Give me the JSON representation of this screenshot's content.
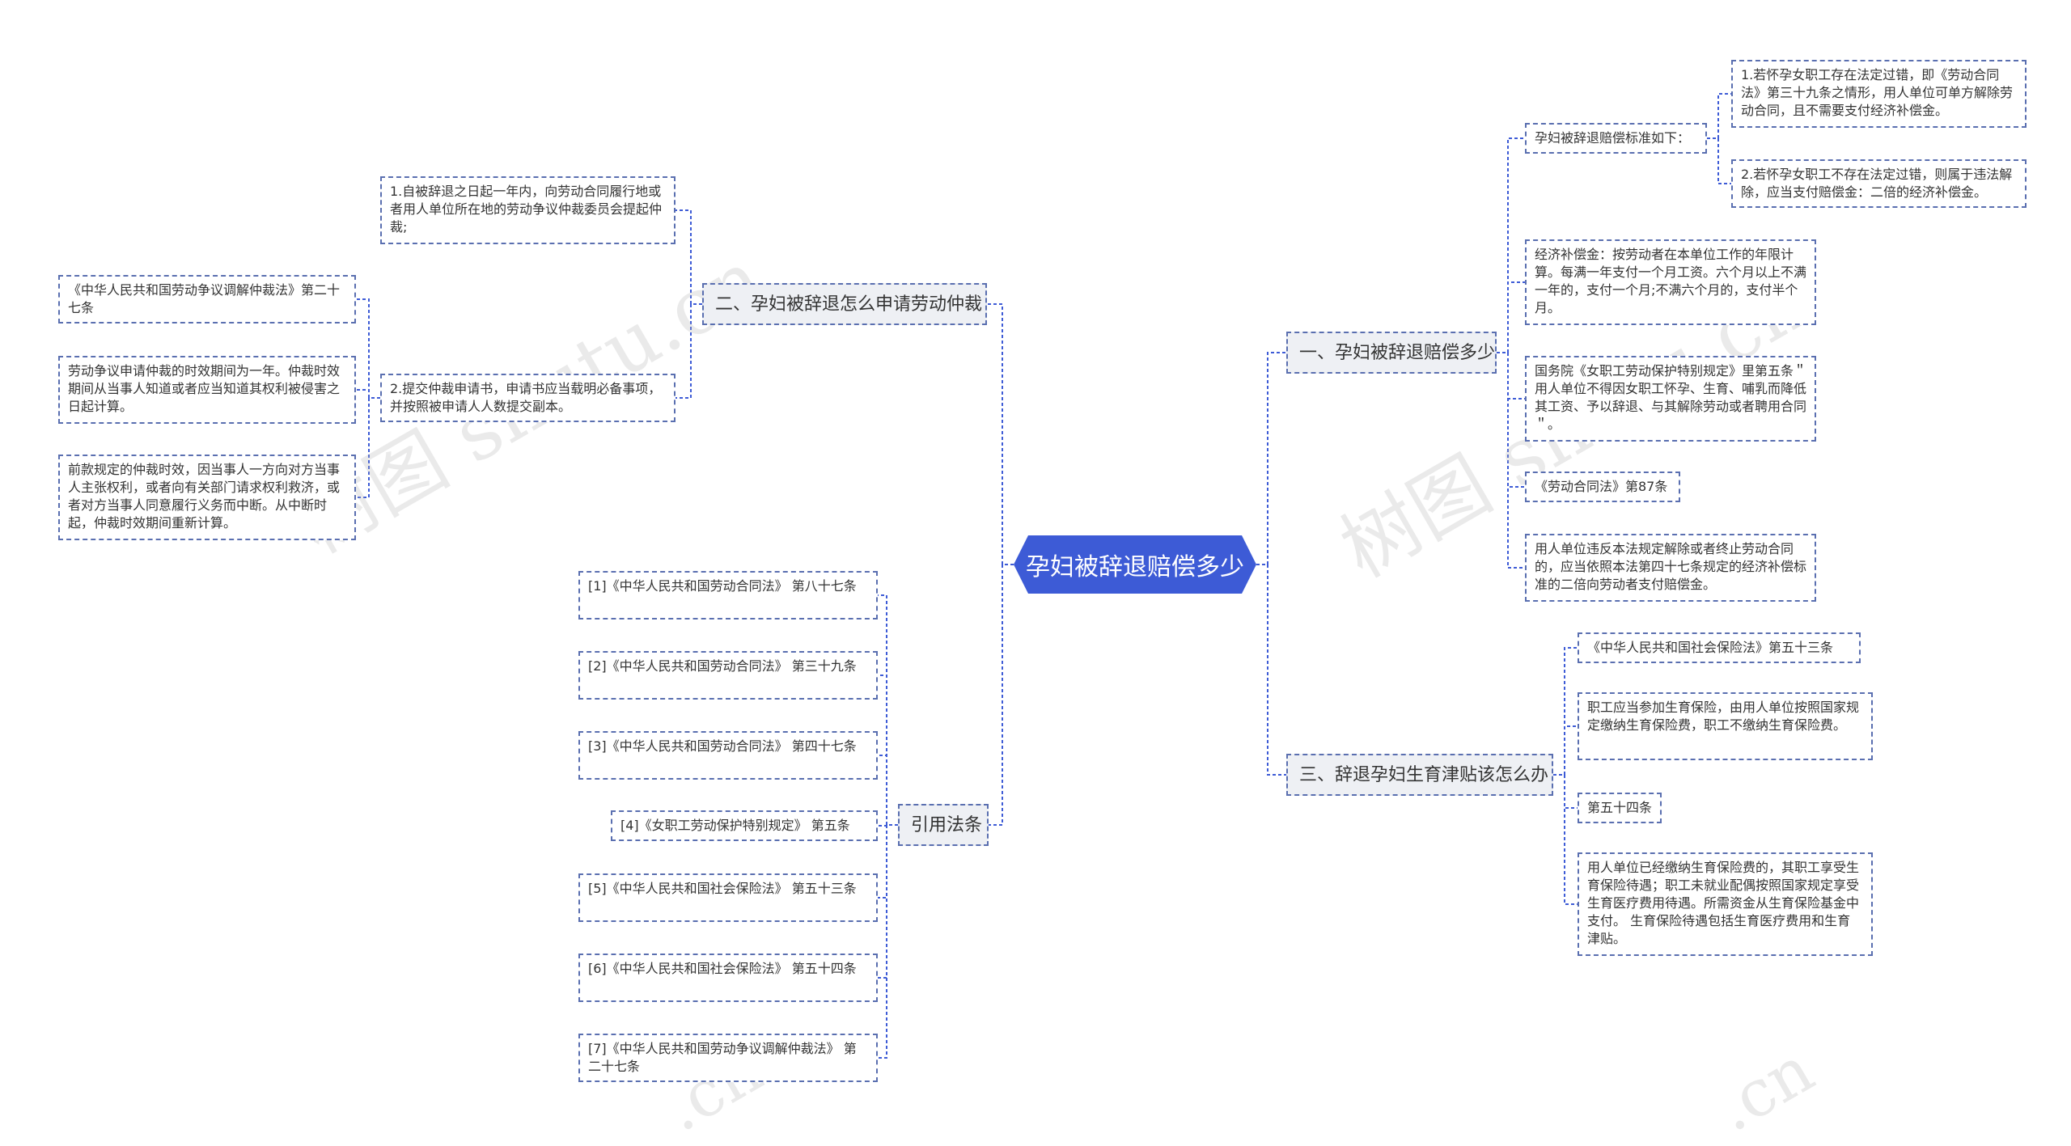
{
  "root": {
    "label": "孕妇被辞退赔偿多少"
  },
  "branches": {
    "b1": {
      "label": "一、孕妇被辞退赔偿多少"
    },
    "b2": {
      "label": "二、孕妇被辞退怎么申请劳动仲裁"
    },
    "b3": {
      "label": "三、辞退孕妇生育津贴该怎么办"
    },
    "b4": {
      "label": "引用法条"
    }
  },
  "b1_children": {
    "standard": "孕妇被辞退赔偿标准如下：",
    "standard_1": "1.若怀孕女职工存在法定过错，即《劳动合同法》第三十九条之情形，用人单位可单方解除劳动合同，且不需要支付经济补偿金。",
    "standard_2": "2.若怀孕女职工不存在法定过错，则属于违法解除，应当支付赔偿金：二倍的经济补偿金。",
    "compensation": "经济补偿金：按劳动者在本单位工作的年限计算。每满一年支付一个月工资。六个月以上不满一年的，支付一个月;不满六个月的，支付半个月。",
    "state_council": "国务院《女职工劳动保护特别规定》里第五条＂用人单位不得因女职工怀孕、生育、哺乳而降低其工资、予以辞退、与其解除劳动或者聘用合同＂。",
    "art87": "《劳动合同法》第87条",
    "art87_text": "用人单位违反本法规定解除或者终止劳动合同的，应当依照本法第四十七条规定的经济补偿标准的二倍向劳动者支付赔偿金。"
  },
  "b2_children": {
    "item1": "1.自被辞退之日起一年内，向劳动合同履行地或者用人单位所在地的劳动争议仲裁委员会提起仲裁;",
    "item2": "2.提交仲裁申请书，申请书应当载明必备事项，并按照被申请人人数提交副本。",
    "law": "《中华人民共和国劳动争议调解仲裁法》第二十七条",
    "limit": "劳动争议申请仲裁的时效期间为一年。仲裁时效期间从当事人知道或者应当知道其权利被侵害之日起计算。",
    "interrupt": "前款规定的仲裁时效，因当事人一方向对方当事人主张权利，或者向有关部门请求权利救济，或者对方当事人同意履行义务而中断。从中断时起，仲裁时效期间重新计算。"
  },
  "b3_children": {
    "law53": "《中华人民共和国社会保险法》第五十三条",
    "law53_text": "职工应当参加生育保险，由用人单位按照国家规定缴纳生育保险费，职工不缴纳生育保险费。",
    "law54": "第五十四条",
    "law54_text": "用人单位已经缴纳生育保险费的，其职工享受生育保险待遇；职工未就业配偶按照国家规定享受生育医疗费用待遇。所需资金从生育保险基金中支付。 生育保险待遇包括生育医疗费用和生育津贴。"
  },
  "refs": [
    "[1]《中华人民共和国劳动合同法》 第八十七条",
    "[2]《中华人民共和国劳动合同法》 第三十九条",
    "[3]《中华人民共和国劳动合同法》 第四十七条",
    "[4]《女职工劳动保护特别规定》 第五条",
    "[5]《中华人民共和国社会保险法》 第五十三条",
    "[6]《中华人民共和国社会保险法》 第五十四条",
    "[7]《中华人民共和国劳动争议调解仲裁法》 第二十七条"
  ],
  "watermark": [
    "树图 shutu.cn",
    "树图 shutu.cn",
    ".cn",
    ".cn"
  ],
  "colors": {
    "root_fill": "#3d5bd6",
    "line": "#3d5bd6",
    "node_border": "#5a6fb0"
  }
}
